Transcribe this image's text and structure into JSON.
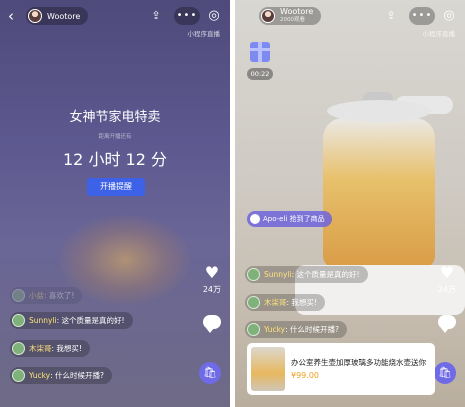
{
  "left": {
    "username": "Wootore",
    "appname": "小程序直播",
    "event_title": "女神节家电特卖",
    "event_subtitle": "距离开播还有",
    "countdown": "12 小时 12 分",
    "remind_button": "开播提醒",
    "likes": "24万",
    "comments": [
      {
        "name": "小盐",
        "text": "喜欢了!"
      },
      {
        "name": "Sunnyli",
        "text": "这个质量是真的好!"
      },
      {
        "name": "木柒哥",
        "text": "我想买!"
      },
      {
        "name": "Yucky",
        "text": "什么时候开播?"
      }
    ]
  },
  "right": {
    "username": "Wootore",
    "viewers": "2000观看",
    "appname": "小程序直播",
    "gift_timer": "00:22",
    "notice": "Apo-eli 抢到了商品",
    "likes": "24万",
    "comments": [
      {
        "name": "Sunnyli",
        "text": "这个质量是真的好!"
      },
      {
        "name": "木柒哥",
        "text": "我想买!"
      },
      {
        "name": "Yucky",
        "text": "什么时候开播?"
      }
    ],
    "product": {
      "name": "办公室养生壶加厚玻璃多功能烧水壶送你",
      "price": "¥99.00"
    }
  },
  "icons": {
    "back": "chevron-left-icon",
    "share": "share-icon",
    "more": "more-icon",
    "target": "target-icon",
    "like": "heart-icon",
    "comment": "comment-icon",
    "cart": "shopping-bag-icon",
    "gift": "gift-icon"
  },
  "colors": {
    "accent": "#3d61e7",
    "cart": "#6f6ae6",
    "comment_name": "#ffe37a",
    "price": "#f0a020"
  }
}
